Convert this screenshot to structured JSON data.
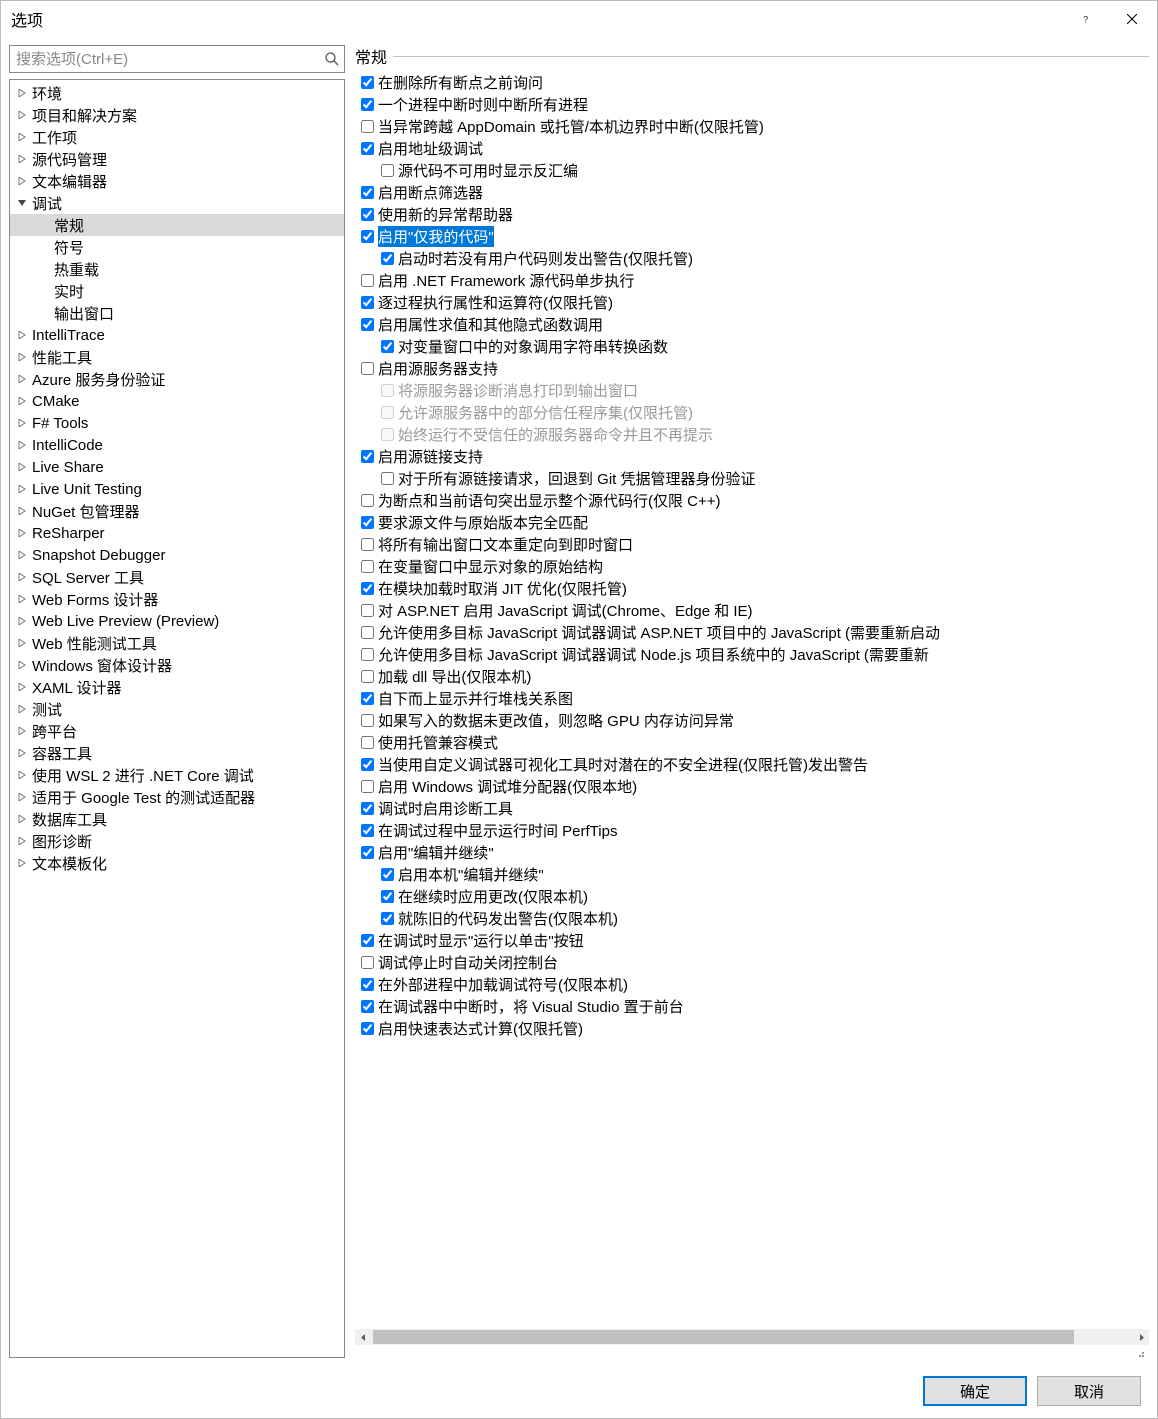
{
  "dialog": {
    "title": "选项"
  },
  "search": {
    "placeholder": "搜索选项(Ctrl+E)"
  },
  "tree": {
    "items": [
      {
        "label": "环境",
        "depth": 0,
        "expandable": true,
        "expanded": false
      },
      {
        "label": "项目和解决方案",
        "depth": 0,
        "expandable": true,
        "expanded": false
      },
      {
        "label": "工作项",
        "depth": 0,
        "expandable": true,
        "expanded": false
      },
      {
        "label": "源代码管理",
        "depth": 0,
        "expandable": true,
        "expanded": false
      },
      {
        "label": "文本编辑器",
        "depth": 0,
        "expandable": true,
        "expanded": false
      },
      {
        "label": "调试",
        "depth": 0,
        "expandable": true,
        "expanded": true
      },
      {
        "label": "常规",
        "depth": 1,
        "expandable": false,
        "selected": true
      },
      {
        "label": "符号",
        "depth": 1,
        "expandable": false
      },
      {
        "label": "热重载",
        "depth": 1,
        "expandable": false
      },
      {
        "label": "实时",
        "depth": 1,
        "expandable": false
      },
      {
        "label": "输出窗口",
        "depth": 1,
        "expandable": false
      },
      {
        "label": "IntelliTrace",
        "depth": 0,
        "expandable": true,
        "expanded": false
      },
      {
        "label": "性能工具",
        "depth": 0,
        "expandable": true,
        "expanded": false
      },
      {
        "label": "Azure 服务身份验证",
        "depth": 0,
        "expandable": true,
        "expanded": false
      },
      {
        "label": "CMake",
        "depth": 0,
        "expandable": true,
        "expanded": false
      },
      {
        "label": "F# Tools",
        "depth": 0,
        "expandable": true,
        "expanded": false
      },
      {
        "label": "IntelliCode",
        "depth": 0,
        "expandable": true,
        "expanded": false
      },
      {
        "label": "Live Share",
        "depth": 0,
        "expandable": true,
        "expanded": false
      },
      {
        "label": "Live Unit Testing",
        "depth": 0,
        "expandable": true,
        "expanded": false
      },
      {
        "label": "NuGet 包管理器",
        "depth": 0,
        "expandable": true,
        "expanded": false
      },
      {
        "label": "ReSharper",
        "depth": 0,
        "expandable": true,
        "expanded": false
      },
      {
        "label": "Snapshot Debugger",
        "depth": 0,
        "expandable": true,
        "expanded": false
      },
      {
        "label": "SQL Server 工具",
        "depth": 0,
        "expandable": true,
        "expanded": false
      },
      {
        "label": "Web Forms 设计器",
        "depth": 0,
        "expandable": true,
        "expanded": false
      },
      {
        "label": "Web Live Preview (Preview)",
        "depth": 0,
        "expandable": true,
        "expanded": false
      },
      {
        "label": "Web 性能测试工具",
        "depth": 0,
        "expandable": true,
        "expanded": false
      },
      {
        "label": "Windows 窗体设计器",
        "depth": 0,
        "expandable": true,
        "expanded": false
      },
      {
        "label": "XAML 设计器",
        "depth": 0,
        "expandable": true,
        "expanded": false
      },
      {
        "label": "测试",
        "depth": 0,
        "expandable": true,
        "expanded": false
      },
      {
        "label": "跨平台",
        "depth": 0,
        "expandable": true,
        "expanded": false
      },
      {
        "label": "容器工具",
        "depth": 0,
        "expandable": true,
        "expanded": false
      },
      {
        "label": "使用 WSL 2 进行 .NET Core 调试",
        "depth": 0,
        "expandable": true,
        "expanded": false
      },
      {
        "label": "适用于 Google Test 的测试适配器",
        "depth": 0,
        "expandable": true,
        "expanded": false
      },
      {
        "label": "数据库工具",
        "depth": 0,
        "expandable": true,
        "expanded": false
      },
      {
        "label": "图形诊断",
        "depth": 0,
        "expandable": true,
        "expanded": false
      },
      {
        "label": "文本模板化",
        "depth": 0,
        "expandable": true,
        "expanded": false
      }
    ]
  },
  "main": {
    "group_label": "常规",
    "options": [
      {
        "label": "在删除所有断点之前询问",
        "checked": true,
        "indent": 0
      },
      {
        "label": "一个进程中断时则中断所有进程",
        "checked": true,
        "indent": 0
      },
      {
        "label": "当异常跨越 AppDomain 或托管/本机边界时中断(仅限托管)",
        "checked": false,
        "indent": 0
      },
      {
        "label": "启用地址级调试",
        "checked": true,
        "indent": 0
      },
      {
        "label": "源代码不可用时显示反汇编",
        "checked": false,
        "indent": 1
      },
      {
        "label": "启用断点筛选器",
        "checked": true,
        "indent": 0
      },
      {
        "label": "使用新的异常帮助器",
        "checked": true,
        "indent": 0
      },
      {
        "label": "启用\"仅我的代码\"",
        "checked": true,
        "indent": 0,
        "highlighted": true
      },
      {
        "label": "启动时若没有用户代码则发出警告(仅限托管)",
        "checked": true,
        "indent": 1
      },
      {
        "label": "启用 .NET Framework 源代码单步执行",
        "checked": false,
        "indent": 0
      },
      {
        "label": "逐过程执行属性和运算符(仅限托管)",
        "checked": true,
        "indent": 0
      },
      {
        "label": "启用属性求值和其他隐式函数调用",
        "checked": true,
        "indent": 0
      },
      {
        "label": "对变量窗口中的对象调用字符串转换函数",
        "checked": true,
        "indent": 1
      },
      {
        "label": "启用源服务器支持",
        "checked": false,
        "indent": 0
      },
      {
        "label": "将源服务器诊断消息打印到输出窗口",
        "checked": false,
        "indent": 1,
        "disabled": true
      },
      {
        "label": "允许源服务器中的部分信任程序集(仅限托管)",
        "checked": false,
        "indent": 1,
        "disabled": true
      },
      {
        "label": "始终运行不受信任的源服务器命令并且不再提示",
        "checked": false,
        "indent": 1,
        "disabled": true
      },
      {
        "label": "启用源链接支持",
        "checked": true,
        "indent": 0
      },
      {
        "label": "对于所有源链接请求，回退到 Git 凭据管理器身份验证",
        "checked": false,
        "indent": 1
      },
      {
        "label": "为断点和当前语句突出显示整个源代码行(仅限 C++)",
        "checked": false,
        "indent": 0
      },
      {
        "label": "要求源文件与原始版本完全匹配",
        "checked": true,
        "indent": 0
      },
      {
        "label": "将所有输出窗口文本重定向到即时窗口",
        "checked": false,
        "indent": 0
      },
      {
        "label": "在变量窗口中显示对象的原始结构",
        "checked": false,
        "indent": 0
      },
      {
        "label": "在模块加载时取消 JIT 优化(仅限托管)",
        "checked": true,
        "indent": 0
      },
      {
        "label": "对 ASP.NET 启用 JavaScript 调试(Chrome、Edge 和 IE)",
        "checked": false,
        "indent": 0
      },
      {
        "label": "允许使用多目标 JavaScript 调试器调试 ASP.NET 项目中的 JavaScript (需要重新启动",
        "checked": false,
        "indent": 0
      },
      {
        "label": "允许使用多目标 JavaScript 调试器调试 Node.js 项目系统中的 JavaScript (需要重新",
        "checked": false,
        "indent": 0
      },
      {
        "label": "加载 dll 导出(仅限本机)",
        "checked": false,
        "indent": 0
      },
      {
        "label": "自下而上显示并行堆栈关系图",
        "checked": true,
        "indent": 0
      },
      {
        "label": "如果写入的数据未更改值，则忽略 GPU 内存访问异常",
        "checked": false,
        "indent": 0
      },
      {
        "label": "使用托管兼容模式",
        "checked": false,
        "indent": 0
      },
      {
        "label": "当使用自定义调试器可视化工具时对潜在的不安全进程(仅限托管)发出警告",
        "checked": true,
        "indent": 0
      },
      {
        "label": "启用 Windows 调试堆分配器(仅限本地)",
        "checked": false,
        "indent": 0
      },
      {
        "label": "调试时启用诊断工具",
        "checked": true,
        "indent": 0
      },
      {
        "label": "在调试过程中显示运行时间 PerfTips",
        "checked": true,
        "indent": 0
      },
      {
        "label": "启用\"编辑并继续\"",
        "checked": true,
        "indent": 0
      },
      {
        "label": "启用本机\"编辑并继续\"",
        "checked": true,
        "indent": 1
      },
      {
        "label": "在继续时应用更改(仅限本机)",
        "checked": true,
        "indent": 1
      },
      {
        "label": "就陈旧的代码发出警告(仅限本机)",
        "checked": true,
        "indent": 1
      },
      {
        "label": "在调试时显示\"运行以单击\"按钮",
        "checked": true,
        "indent": 0
      },
      {
        "label": "调试停止时自动关闭控制台",
        "checked": false,
        "indent": 0
      },
      {
        "label": "在外部进程中加载调试符号(仅限本机)",
        "checked": true,
        "indent": 0
      },
      {
        "label": "在调试器中中断时，将 Visual Studio 置于前台",
        "checked": true,
        "indent": 0
      },
      {
        "label": "启用快速表达式计算(仅限托管)",
        "checked": true,
        "indent": 0
      }
    ]
  },
  "footer": {
    "ok": "确定",
    "cancel": "取消"
  }
}
